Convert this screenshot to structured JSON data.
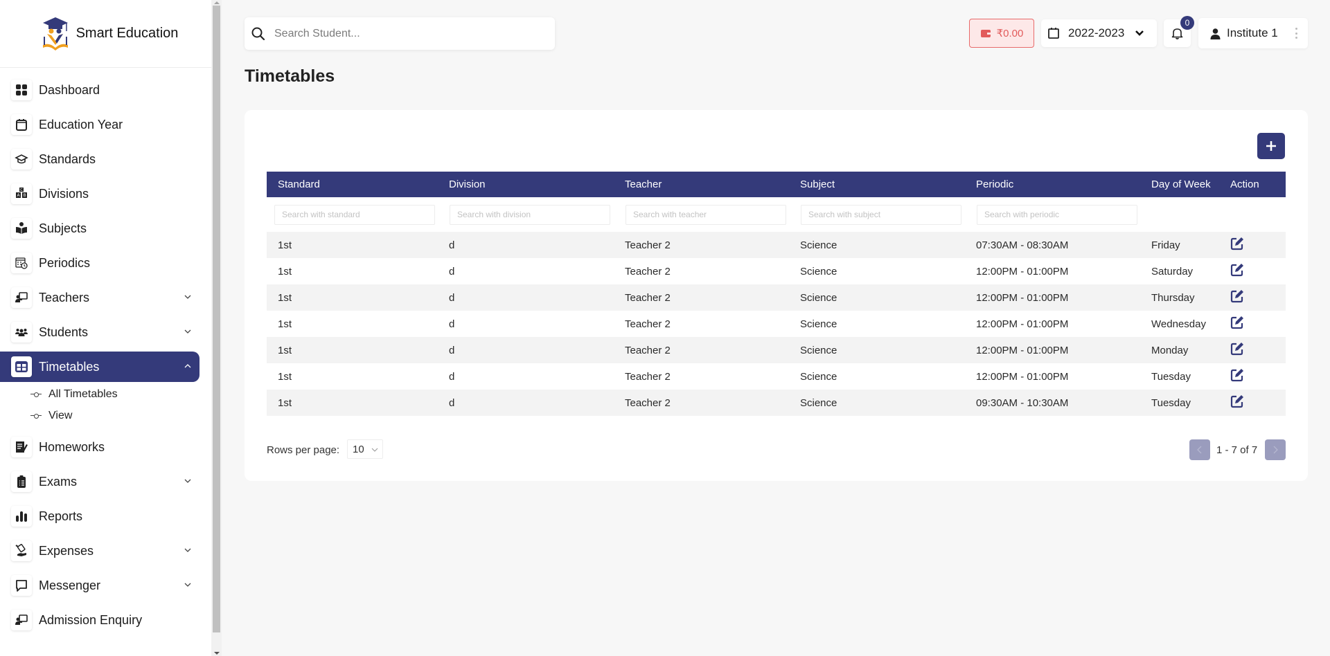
{
  "app": {
    "brand_name": "Smart Education"
  },
  "sidebar": {
    "items": [
      {
        "label": "Dashboard",
        "icon": "dashboard-grid-icon",
        "has_chevron": false
      },
      {
        "label": "Education Year",
        "icon": "calendar-icon",
        "has_chevron": false
      },
      {
        "label": "Standards",
        "icon": "graduation-cap-icon",
        "has_chevron": false
      },
      {
        "label": "Divisions",
        "icon": "abc-blocks-icon",
        "has_chevron": false
      },
      {
        "label": "Subjects",
        "icon": "reader-book-icon",
        "has_chevron": false
      },
      {
        "label": "Periodics",
        "icon": "calendar-clock-icon",
        "has_chevron": false
      },
      {
        "label": "Teachers",
        "icon": "chalkboard-teacher-icon",
        "has_chevron": true
      },
      {
        "label": "Students",
        "icon": "users-group-icon",
        "has_chevron": true
      },
      {
        "label": "Timetables",
        "icon": "table-icon",
        "has_chevron": true,
        "active": true
      },
      {
        "label": "Homeworks",
        "icon": "notebook-pen-icon",
        "has_chevron": false
      },
      {
        "label": "Exams",
        "icon": "clipboard-list-icon",
        "has_chevron": true
      },
      {
        "label": "Reports",
        "icon": "bar-chart-icon",
        "has_chevron": false
      },
      {
        "label": "Expenses",
        "icon": "hand-money-icon",
        "has_chevron": true
      },
      {
        "label": "Messenger",
        "icon": "message-square-icon",
        "has_chevron": true
      },
      {
        "label": "Admission Enquiry",
        "icon": "chalkboard-teacher-icon",
        "has_chevron": false
      }
    ],
    "timetable_sub": [
      {
        "label": "All Timetables"
      },
      {
        "label": "View"
      }
    ]
  },
  "topbar": {
    "search_placeholder": "Search Student...",
    "wallet_amount": "₹0.00",
    "education_year": "2022-2023",
    "notification_count": "0",
    "profile_name": "Institute 1"
  },
  "page": {
    "title": "Timetables"
  },
  "table": {
    "columns": [
      "Standard",
      "Division",
      "Teacher",
      "Subject",
      "Periodic",
      "Day of Week",
      "Action"
    ],
    "filter_placeholders": [
      "Search with standard",
      "Search with division",
      "Search with teacher",
      "Search with subject",
      "Search with periodic"
    ],
    "rows": [
      {
        "standard": "1st",
        "division": "d",
        "teacher": "Teacher 2",
        "subject": "Science",
        "periodic": "07:30AM - 08:30AM",
        "day": "Friday"
      },
      {
        "standard": "1st",
        "division": "d",
        "teacher": "Teacher 2",
        "subject": "Science",
        "periodic": "12:00PM - 01:00PM",
        "day": "Saturday"
      },
      {
        "standard": "1st",
        "division": "d",
        "teacher": "Teacher 2",
        "subject": "Science",
        "periodic": "12:00PM - 01:00PM",
        "day": "Thursday"
      },
      {
        "standard": "1st",
        "division": "d",
        "teacher": "Teacher 2",
        "subject": "Science",
        "periodic": "12:00PM - 01:00PM",
        "day": "Wednesday"
      },
      {
        "standard": "1st",
        "division": "d",
        "teacher": "Teacher 2",
        "subject": "Science",
        "periodic": "12:00PM - 01:00PM",
        "day": "Monday"
      },
      {
        "standard": "1st",
        "division": "d",
        "teacher": "Teacher 2",
        "subject": "Science",
        "periodic": "12:00PM - 01:00PM",
        "day": "Tuesday"
      },
      {
        "standard": "1st",
        "division": "d",
        "teacher": "Teacher 2",
        "subject": "Science",
        "periodic": "09:30AM - 10:30AM",
        "day": "Tuesday"
      }
    ]
  },
  "pagination": {
    "rows_per_page_label": "Rows per page:",
    "rows_per_page_value": "10",
    "range_text": "1 - 7 of 7"
  },
  "colors": {
    "primary": "#343a7a",
    "wallet_bg": "#fde8e8",
    "wallet_fg": "#e25b5b",
    "pager_disabled": "#9a9cbd"
  }
}
